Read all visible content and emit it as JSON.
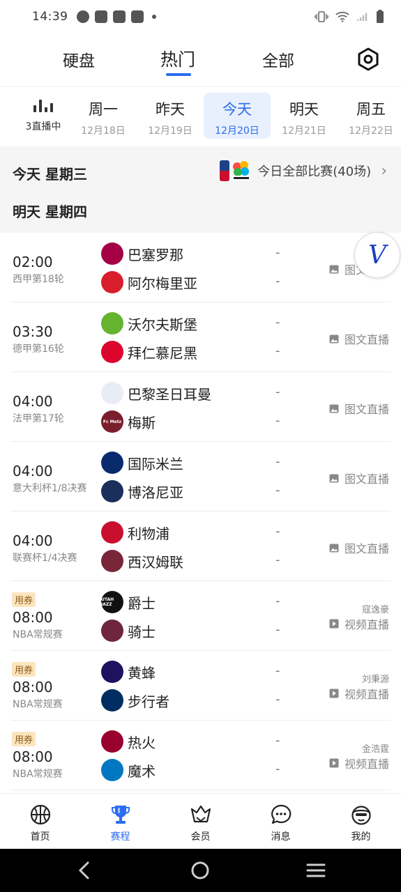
{
  "status_bar": {
    "time": "14:39"
  },
  "top_tabs": [
    {
      "label": "硬盘",
      "active": false
    },
    {
      "label": "热门",
      "active": true
    },
    {
      "label": "全部",
      "active": false
    }
  ],
  "day_selector": {
    "live": {
      "label": "3直播中"
    },
    "days": [
      {
        "name": "周一",
        "date": "12月18日"
      },
      {
        "name": "昨天",
        "date": "12月19日"
      },
      {
        "name": "今天",
        "date": "12月20日",
        "active": true
      },
      {
        "name": "明天",
        "date": "12月21日"
      },
      {
        "name": "周五",
        "date": "12月22日"
      }
    ]
  },
  "header": {
    "today": "今天 星期三",
    "all_matches": "今日全部比赛(40场)",
    "tomorrow": "明天 星期四"
  },
  "matches": [
    {
      "time": "02:00",
      "league": "西甲第18轮",
      "home": "巴塞罗那",
      "away": "阿尔梅里亚",
      "home_score": "-",
      "away_score": "-",
      "broadcast": "图文直播",
      "home_color": "#a50044",
      "away_color": "#d81e2b"
    },
    {
      "time": "03:30",
      "league": "德甲第16轮",
      "home": "沃尔夫斯堡",
      "away": "拜仁慕尼黑",
      "home_score": "-",
      "away_score": "-",
      "broadcast": "图文直播",
      "home_color": "#65b32e",
      "away_color": "#dc052d"
    },
    {
      "time": "04:00",
      "league": "法甲第17轮",
      "home": "巴黎圣日耳曼",
      "away": "梅斯",
      "home_score": "-",
      "away_score": "-",
      "broadcast": "图文直播",
      "home_color": "#e8ecf5",
      "away_color": "#7a1e2c",
      "away_logo_text": "Fc Metz"
    },
    {
      "time": "04:00",
      "league": "意大利杯1/8决赛",
      "home": "国际米兰",
      "away": "博洛尼亚",
      "home_score": "-",
      "away_score": "-",
      "broadcast": "图文直播",
      "home_color": "#0a2a6e",
      "away_color": "#1a2f5c"
    },
    {
      "time": "04:00",
      "league": "联赛杯1/4决赛",
      "home": "利物浦",
      "away": "西汉姆联",
      "home_score": "-",
      "away_score": "-",
      "broadcast": "图文直播",
      "home_color": "#c8102e",
      "away_color": "#7a263a"
    },
    {
      "badge": "用券",
      "time": "08:00",
      "league": "NBA常规赛",
      "home": "爵士",
      "away": "骑士",
      "home_score": "-",
      "away_score": "-",
      "commentator": "寇逸豪",
      "broadcast": "视频直播",
      "home_color": "#111111",
      "away_color": "#6f263d",
      "home_logo_text": "UTAH JAZZ"
    },
    {
      "badge": "用券",
      "time": "08:00",
      "league": "NBA常规赛",
      "home": "黄蜂",
      "away": "步行者",
      "home_score": "-",
      "away_score": "-",
      "commentator": "刘秉源",
      "broadcast": "视频直播",
      "home_color": "#1d1160",
      "away_color": "#002d62"
    },
    {
      "badge": "用券",
      "time": "08:00",
      "league": "NBA常规赛",
      "home": "热火",
      "away": "魔术",
      "home_score": "-",
      "away_score": "-",
      "commentator": "金浩霆",
      "broadcast": "视频直播",
      "home_color": "#98002e",
      "away_color": "#0077c0"
    }
  ],
  "bottom_nav": [
    {
      "label": "首页",
      "icon": "basketball-icon"
    },
    {
      "label": "赛程",
      "icon": "trophy-icon",
      "active": true
    },
    {
      "label": "会员",
      "icon": "diamond-crown-icon"
    },
    {
      "label": "消息",
      "icon": "chat-bubble-icon"
    },
    {
      "label": "我的",
      "icon": "profile-face-icon"
    }
  ],
  "colors": {
    "accent": "#2b6df0",
    "badge_bg": "#fbe4bd",
    "section_bg": "#f5f5f5"
  }
}
